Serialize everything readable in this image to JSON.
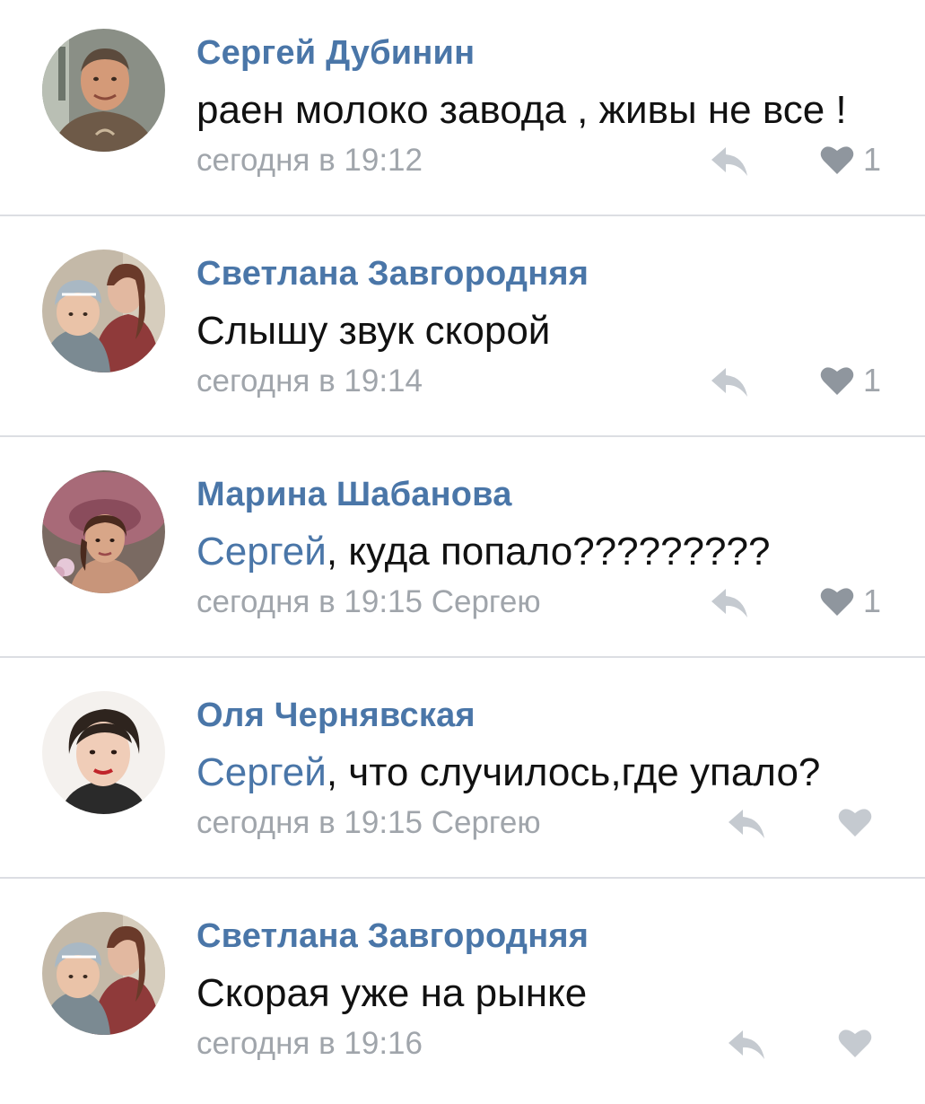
{
  "colors": {
    "link": "#4a76a8",
    "text": "#111111",
    "meta": "#a0a5ab",
    "icon_active": "#8f969e",
    "icon_inactive": "#c5cad0",
    "divider": "#dcdee3"
  },
  "comments": [
    {
      "author": "Сергей Дубинин",
      "mention": "",
      "text": "раен молоко завода , живы не все !",
      "meta": "сегодня в 19:12",
      "likes": "1",
      "avatar_icon": "avatar-man-icon"
    },
    {
      "author": "Светлана Завгородняя",
      "mention": "",
      "text": "Слышу звук  скорой",
      "meta": "сегодня в 19:14",
      "likes": "1",
      "avatar_icon": "avatar-woman-child-icon"
    },
    {
      "author": "Марина Шабанова",
      "mention": "Сергей",
      "text": ", куда попало?????????",
      "meta": "сегодня в 19:15 Сергею",
      "likes": "1",
      "avatar_icon": "avatar-woman-hat-icon"
    },
    {
      "author": "Оля Чернявская",
      "mention": "Сергей",
      "text": ", что случилось,где упало?",
      "meta": "сегодня в 19:15 Сергею",
      "likes": "",
      "avatar_icon": "avatar-woman-icon"
    },
    {
      "author": "Светлана Завгородняя",
      "mention": "",
      "text": "Скорая уже на рынке",
      "meta": "сегодня в 19:16",
      "likes": "",
      "avatar_icon": "avatar-woman-child-icon"
    }
  ]
}
